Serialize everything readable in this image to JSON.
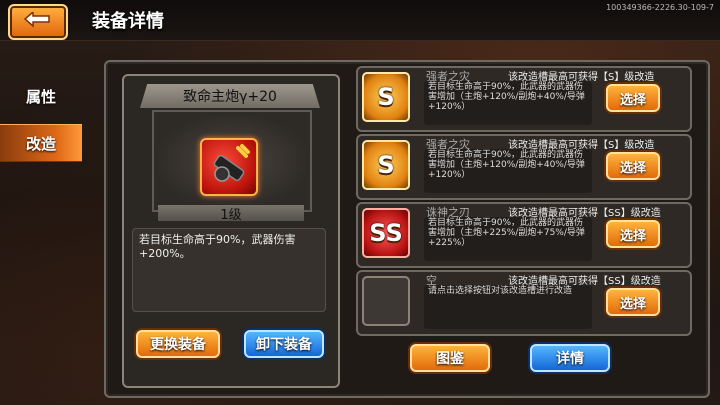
{
  "header": {
    "title": "装备详情",
    "id_text": "100349366-2226.30-109-7"
  },
  "sidebar": {
    "items": [
      {
        "label": "属性",
        "active": false
      },
      {
        "label": "改造",
        "active": true
      }
    ]
  },
  "equipment": {
    "name": "致命主炮γ+20",
    "level": "1级",
    "description": "若目标生命高于90%，武器伤害+200%。",
    "icon": "cannon-icon",
    "buttons": {
      "change": "更换装备",
      "unequip": "卸下装备"
    }
  },
  "slots": [
    {
      "badge": "S",
      "title": "强者之灾",
      "grade_text": "该改造槽最高可获得【S】级改造",
      "desc": "若目标生命高于90%，此武器的武器伤害增加（主炮+120%/副炮+40%/导弹+120%）",
      "button": "选择"
    },
    {
      "badge": "S",
      "title": "强者之灾",
      "grade_text": "该改造槽最高可获得【S】级改造",
      "desc": "若目标生命高于90%，此武器的武器伤害增加（主炮+120%/副炮+40%/导弹+120%）",
      "button": "选择"
    },
    {
      "badge": "SS",
      "title": "诛神之刃",
      "grade_text": "该改造槽最高可获得【SS】级改造",
      "desc": "若目标生命高于90%，此武器的武器伤害增加（主炮+225%/副炮+75%/导弹+225%）",
      "button": "选择"
    },
    {
      "badge": "",
      "title": "空",
      "grade_text": "该改造槽最高可获得【SS】级改造",
      "desc": "请点击选择按钮对该改造槽进行改造",
      "button": "选择"
    }
  ],
  "footer": {
    "catalog": "图鉴",
    "details": "详情"
  },
  "colors": {
    "accent_orange": "#e26a0c",
    "accent_blue": "#1566d6",
    "panel_border": "#6e6a62"
  }
}
